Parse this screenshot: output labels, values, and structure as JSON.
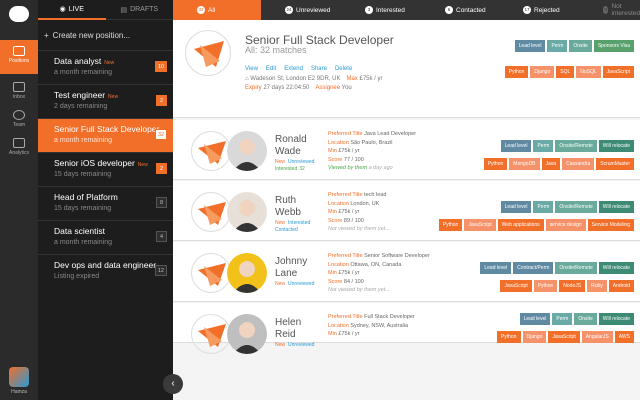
{
  "rail": {
    "positions": "Positions",
    "inbox": "Inbox",
    "team": "Team",
    "analytics": "Analytics",
    "user": "Hamza"
  },
  "list": {
    "tab_live": "LIVE",
    "tab_drafts": "DRAFTS",
    "create": "Create new position...",
    "items": [
      {
        "title": "Data analyst",
        "new": "New",
        "sub": "a month remaining",
        "count": "10",
        "active": false,
        "grey": false
      },
      {
        "title": "Test engineer",
        "new": "New",
        "sub": "2 days remaining",
        "count": "2",
        "active": false,
        "grey": false
      },
      {
        "title": "Senior Full Stack Developer...",
        "new": "",
        "sub": "a month remaining",
        "count": "32",
        "active": true,
        "grey": false
      },
      {
        "title": "Senior iOS developer",
        "new": "New",
        "sub": "15 days remaining",
        "count": "2",
        "active": false,
        "grey": false
      },
      {
        "title": "Head of Platform",
        "new": "",
        "sub": "15 days remaining",
        "count": "8",
        "active": false,
        "grey": true
      },
      {
        "title": "Data scientist",
        "new": "",
        "sub": "a month remaining",
        "count": "4",
        "active": false,
        "grey": true
      },
      {
        "title": "Dev ops and data engineer",
        "new": "",
        "sub": "Listing expired",
        "count": "12",
        "active": false,
        "grey": true
      }
    ]
  },
  "stages": [
    {
      "num": "32",
      "label": "All"
    },
    {
      "num": "24",
      "label": "Unreviewed"
    },
    {
      "num": "3",
      "label": "Interested"
    },
    {
      "num": "6",
      "label": "Contacted"
    },
    {
      "num": "17",
      "label": "Rejected"
    },
    {
      "num": "0",
      "label": "Not interested"
    }
  ],
  "header": {
    "title": "Senior Full Stack Developer",
    "sub": "All: 32 matches",
    "actions": [
      "View",
      "Edit",
      "Extend",
      "Share",
      "Delete"
    ],
    "address": "Wadeson St, London E2 9DR, UK",
    "max": "Max",
    "salary": "£75k / yr",
    "expiry": "Expiry",
    "expiry_val": "27 days 22:04:50",
    "assignee": "Assignee",
    "assignee_val": "You",
    "tags": [
      "Lead level",
      "Perm",
      "Onsite",
      "Sponsors Visa"
    ],
    "skills": [
      "Python",
      "Django",
      "SQL",
      "NoSQL",
      "JavaScript"
    ]
  },
  "labels": {
    "pref": "Preferred Title",
    "loc": "Location",
    "min": "Min",
    "score": "Score"
  },
  "candidates": [
    {
      "first": "Ronald",
      "last": "Wade",
      "status1": "New",
      "status2": "Unreviewed",
      "status3": "Interested",
      "status3_count": "32",
      "title": "Java Lead Developer",
      "location": "São Paulo, Brazil",
      "min": "£75k / yr",
      "score": "77 / 100",
      "viewed": "Viewed by them",
      "viewed_when": "a day ago",
      "tags": [
        "Lead level",
        "Perm",
        "Onsite/Remote",
        "Will relocate"
      ],
      "skills": [
        "Python",
        "MongoDB",
        "Java",
        "Cassandra",
        "ScrumMaster"
      ]
    },
    {
      "first": "Ruth",
      "last": "Webb",
      "status1": "New",
      "status2": "Interested",
      "status3": "Contacted",
      "status3_count": "",
      "title": "tech lead",
      "location": "London, UK",
      "min": "£75k / yr",
      "score": "89 / 100",
      "viewed": "Not viewed by them yet...",
      "viewed_when": "",
      "tags": [
        "Lead level",
        "Perm",
        "Onsite/Remote",
        "Will relocate"
      ],
      "skills": [
        "Python",
        "JavaScript",
        "Web applications",
        "service design",
        "Service Modeling"
      ]
    },
    {
      "first": "Johnny",
      "last": "Lane",
      "status1": "New",
      "status2": "Unreviewed",
      "status3": "",
      "status3_count": "",
      "title": "Senior Software Developer",
      "location": "Ottawa, ON, Canada",
      "min": "£75k / yr",
      "score": "84 / 100",
      "viewed": "Not viewed by them yet...",
      "viewed_when": "",
      "tags": [
        "Lead level",
        "Contract/Perm",
        "Onsite/Remote",
        "Will relocate"
      ],
      "skills": [
        "JavaScript",
        "Python",
        "NodeJS",
        "Ruby",
        "Android"
      ]
    },
    {
      "first": "Helen",
      "last": "Reid",
      "status1": "New",
      "status2": "Unreviewed",
      "status3": "",
      "status3_count": "",
      "title": "Full Stack Developer",
      "location": "Sydney, NSW, Australia",
      "min": "£75k / yr",
      "score": "",
      "viewed": "",
      "viewed_when": "",
      "tags": [
        "Lead level",
        "Perm",
        "Onsite",
        "Will relocate"
      ],
      "skills": [
        "Python",
        "Django",
        "JavaScript",
        "AngularJS",
        "AWS"
      ]
    }
  ]
}
